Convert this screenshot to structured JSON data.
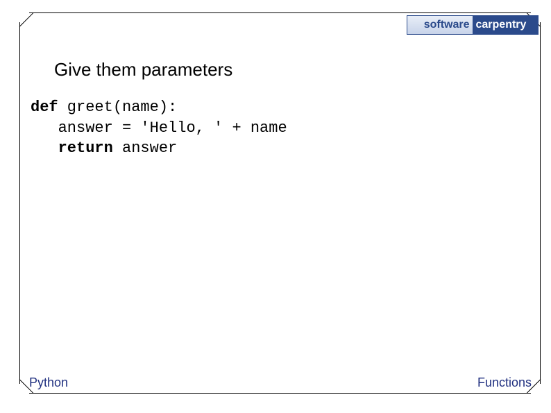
{
  "logo": {
    "left": "software",
    "right": "carpentry"
  },
  "heading": "Give them parameters",
  "code": {
    "kw_def": "def",
    "sig": " greet(name):",
    "line2": "answer = 'Hello, ' + name",
    "kw_return": "return",
    "ret_rest": " answer"
  },
  "footer": {
    "left": "Python",
    "right": "Functions"
  }
}
